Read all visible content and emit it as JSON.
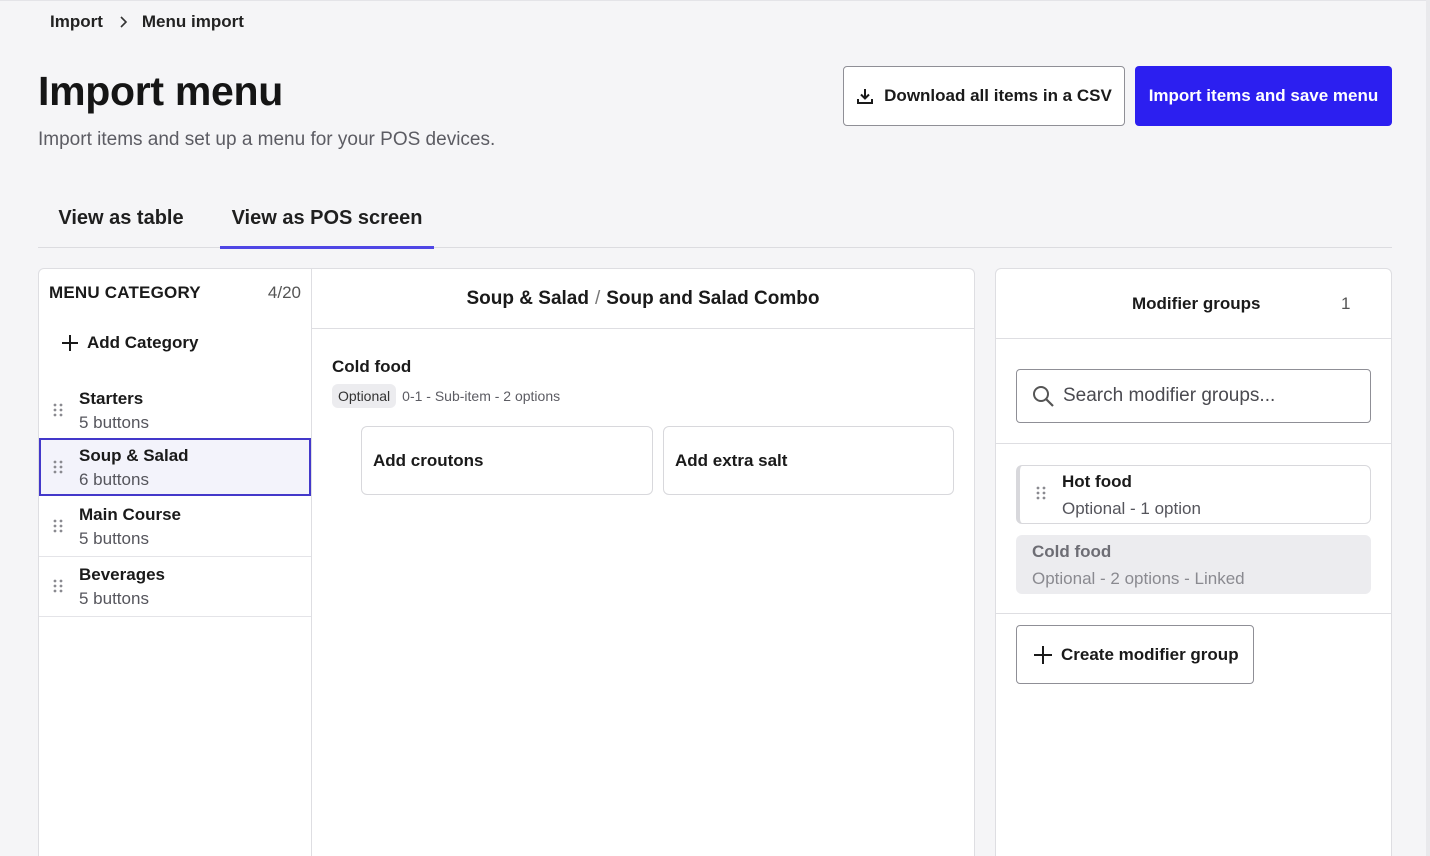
{
  "breadcrumb": {
    "root": "Import",
    "current": "Menu import"
  },
  "header": {
    "title": "Import menu",
    "subtitle": "Import items and set up a menu for your POS devices.",
    "download_label": "Download all items in a CSV",
    "import_label": "Import items and save menu"
  },
  "tabs": [
    {
      "label": "View as table",
      "active": false
    },
    {
      "label": "View as POS screen",
      "active": true
    }
  ],
  "categories": {
    "header": "MENU CATEGORY",
    "count": "4/20",
    "add_label": "Add Category",
    "items": [
      {
        "name": "Starters",
        "sub": "5 buttons",
        "selected": false
      },
      {
        "name": "Soup & Salad",
        "sub": "6 buttons",
        "selected": true
      },
      {
        "name": "Main Course",
        "sub": "5 buttons",
        "selected": false
      },
      {
        "name": "Beverages",
        "sub": "5 buttons",
        "selected": false
      }
    ]
  },
  "item_view": {
    "category": "Soup & Salad",
    "separator": "/",
    "item": "Soup and Salad Combo",
    "group": {
      "title": "Cold food",
      "badge": "Optional",
      "meta": "0-1 - Sub-item - 2 options",
      "options": [
        "Add croutons",
        "Add extra salt"
      ]
    }
  },
  "modifiers": {
    "title": "Modifier groups",
    "count": "1",
    "search_placeholder": "Search modifier groups...",
    "groups": [
      {
        "name": "Hot food",
        "sub": "Optional - 1 option",
        "linked": false
      },
      {
        "name": "Cold food",
        "sub": "Optional - 2 options - Linked",
        "linked": true
      }
    ],
    "create_label": "Create modifier group"
  },
  "icons": {
    "breadcrumb_sep": "chevron-right-icon",
    "download": "download-icon",
    "add": "plus-icon",
    "drag": "drag-handle-icon",
    "search": "search-icon"
  },
  "colors": {
    "primary": "#2c1ff0",
    "tab_indicator": "#4f46e5",
    "selected_border": "#4338ca",
    "background": "#f5f5f7"
  }
}
